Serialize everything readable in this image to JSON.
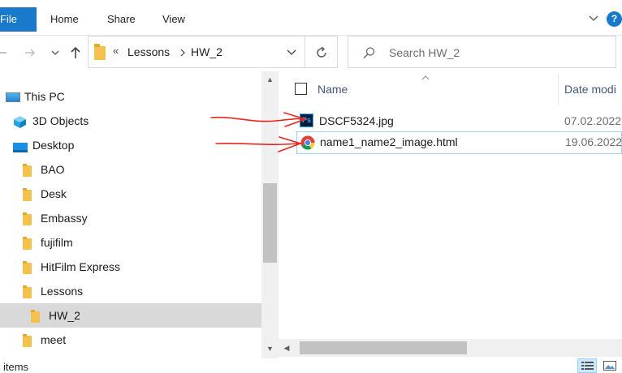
{
  "ribbon": {
    "file_tab": "File",
    "tabs": [
      "Home",
      "Share",
      "View"
    ],
    "help_label": "?"
  },
  "address_bar": {
    "overflow": "«",
    "crumbs": [
      "Lessons",
      "HW_2"
    ]
  },
  "search": {
    "placeholder": "Search HW_2"
  },
  "nav_tree": {
    "items": [
      {
        "label": "This PC",
        "icon": "computer-icon"
      },
      {
        "label": "3D Objects",
        "icon": "3d-objects-icon"
      },
      {
        "label": "Desktop",
        "icon": "desktop-icon"
      },
      {
        "label": "BAO",
        "icon": "folder-icon"
      },
      {
        "label": "Desk",
        "icon": "folder-icon"
      },
      {
        "label": "Embassy",
        "icon": "folder-icon"
      },
      {
        "label": "fujifilm",
        "icon": "folder-icon"
      },
      {
        "label": "HitFilm Express",
        "icon": "folder-icon"
      },
      {
        "label": "Lessons",
        "icon": "folder-icon"
      },
      {
        "label": "HW_2",
        "icon": "folder-icon",
        "selected": true
      },
      {
        "label": "meet",
        "icon": "folder-icon"
      }
    ]
  },
  "file_list": {
    "columns": {
      "name": "Name",
      "date": "Date modi"
    },
    "files": [
      {
        "name": "DSCF5324.jpg",
        "date": "07.02.2022",
        "icon": "photoshop-icon"
      },
      {
        "name": "name1_name2_image.html",
        "date": "19.06.2022",
        "icon": "chrome-icon"
      }
    ]
  },
  "status_bar": {
    "text": "items"
  },
  "colors": {
    "accent": "#1979ca",
    "selection": "#d9d9d9",
    "annotation": "#e8261f"
  }
}
